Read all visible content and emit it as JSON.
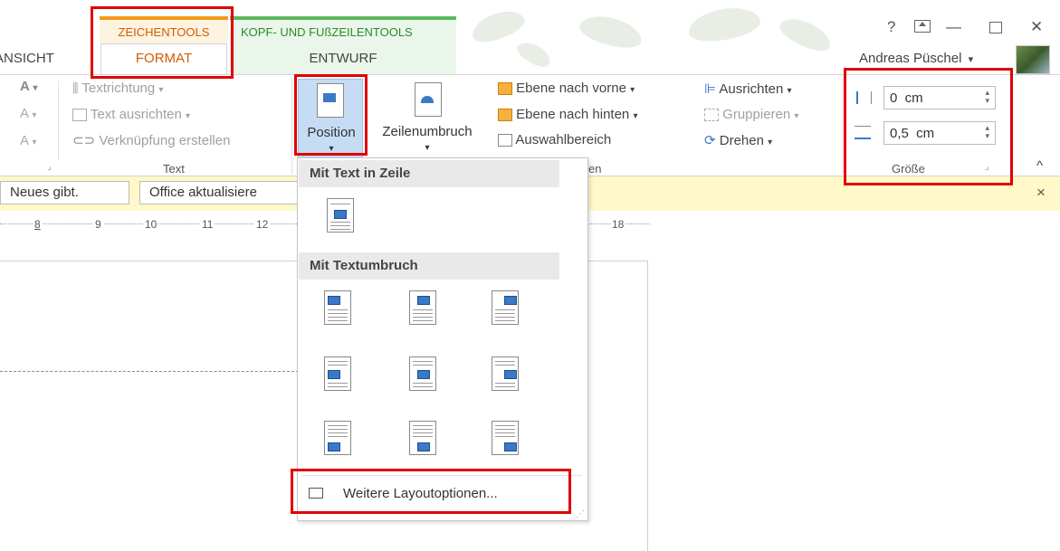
{
  "tabs": {
    "partial_left": "ANSICHT",
    "context_zeichentools": "ZEICHENTOOLS",
    "context_kopf": "KOPF- UND FUßZEILENTOOLS",
    "format": "FORMAT",
    "entwurf": "ENTWURF"
  },
  "window": {
    "help": "?",
    "restore_ribbon": "⊡",
    "minimize": "—",
    "maximize": "🗗",
    "close": "✕",
    "user_name": "Andreas Püschel",
    "user_caret": "▾"
  },
  "ribbon": {
    "text_group": {
      "textrichtung": "Textrichtung",
      "text_ausrichten": "Text ausrichten",
      "verknuepfung": "Verknüpfung erstellen",
      "label": "Text"
    },
    "position": {
      "label": "Position",
      "caret": "▾"
    },
    "zeilenumbruch": {
      "label": "Zeilenumbruch",
      "caret": "▾"
    },
    "arrange": {
      "ebene_vorne": "Ebene nach vorne",
      "ebene_hinten": "Ebene nach hinten",
      "auswahlbereich": "Auswahlbereich",
      "ausrichten": "Ausrichten",
      "gruppieren": "Gruppieren",
      "drehen": "Drehen",
      "label_partial": "en"
    },
    "size": {
      "height_value": "0  cm",
      "width_value": "0,5  cm",
      "label": "Größe"
    },
    "collapse": "^"
  },
  "notification": {
    "btn1": "Neues gibt.",
    "btn2": "Office aktualisiere",
    "close": "×"
  },
  "ruler": {
    "labels": [
      "8",
      "9",
      "10",
      "11",
      "12",
      "18"
    ]
  },
  "dropdown": {
    "section1": "Mit Text in Zeile",
    "section2": "Mit Textumbruch",
    "more_options": "Weitere Layoutoptionen..."
  },
  "colors": {
    "highlight_red": "#e00000",
    "format_accent": "#d25c00",
    "entwurf_green": "#2b8a2b",
    "notification_bg": "#fff8c9"
  }
}
